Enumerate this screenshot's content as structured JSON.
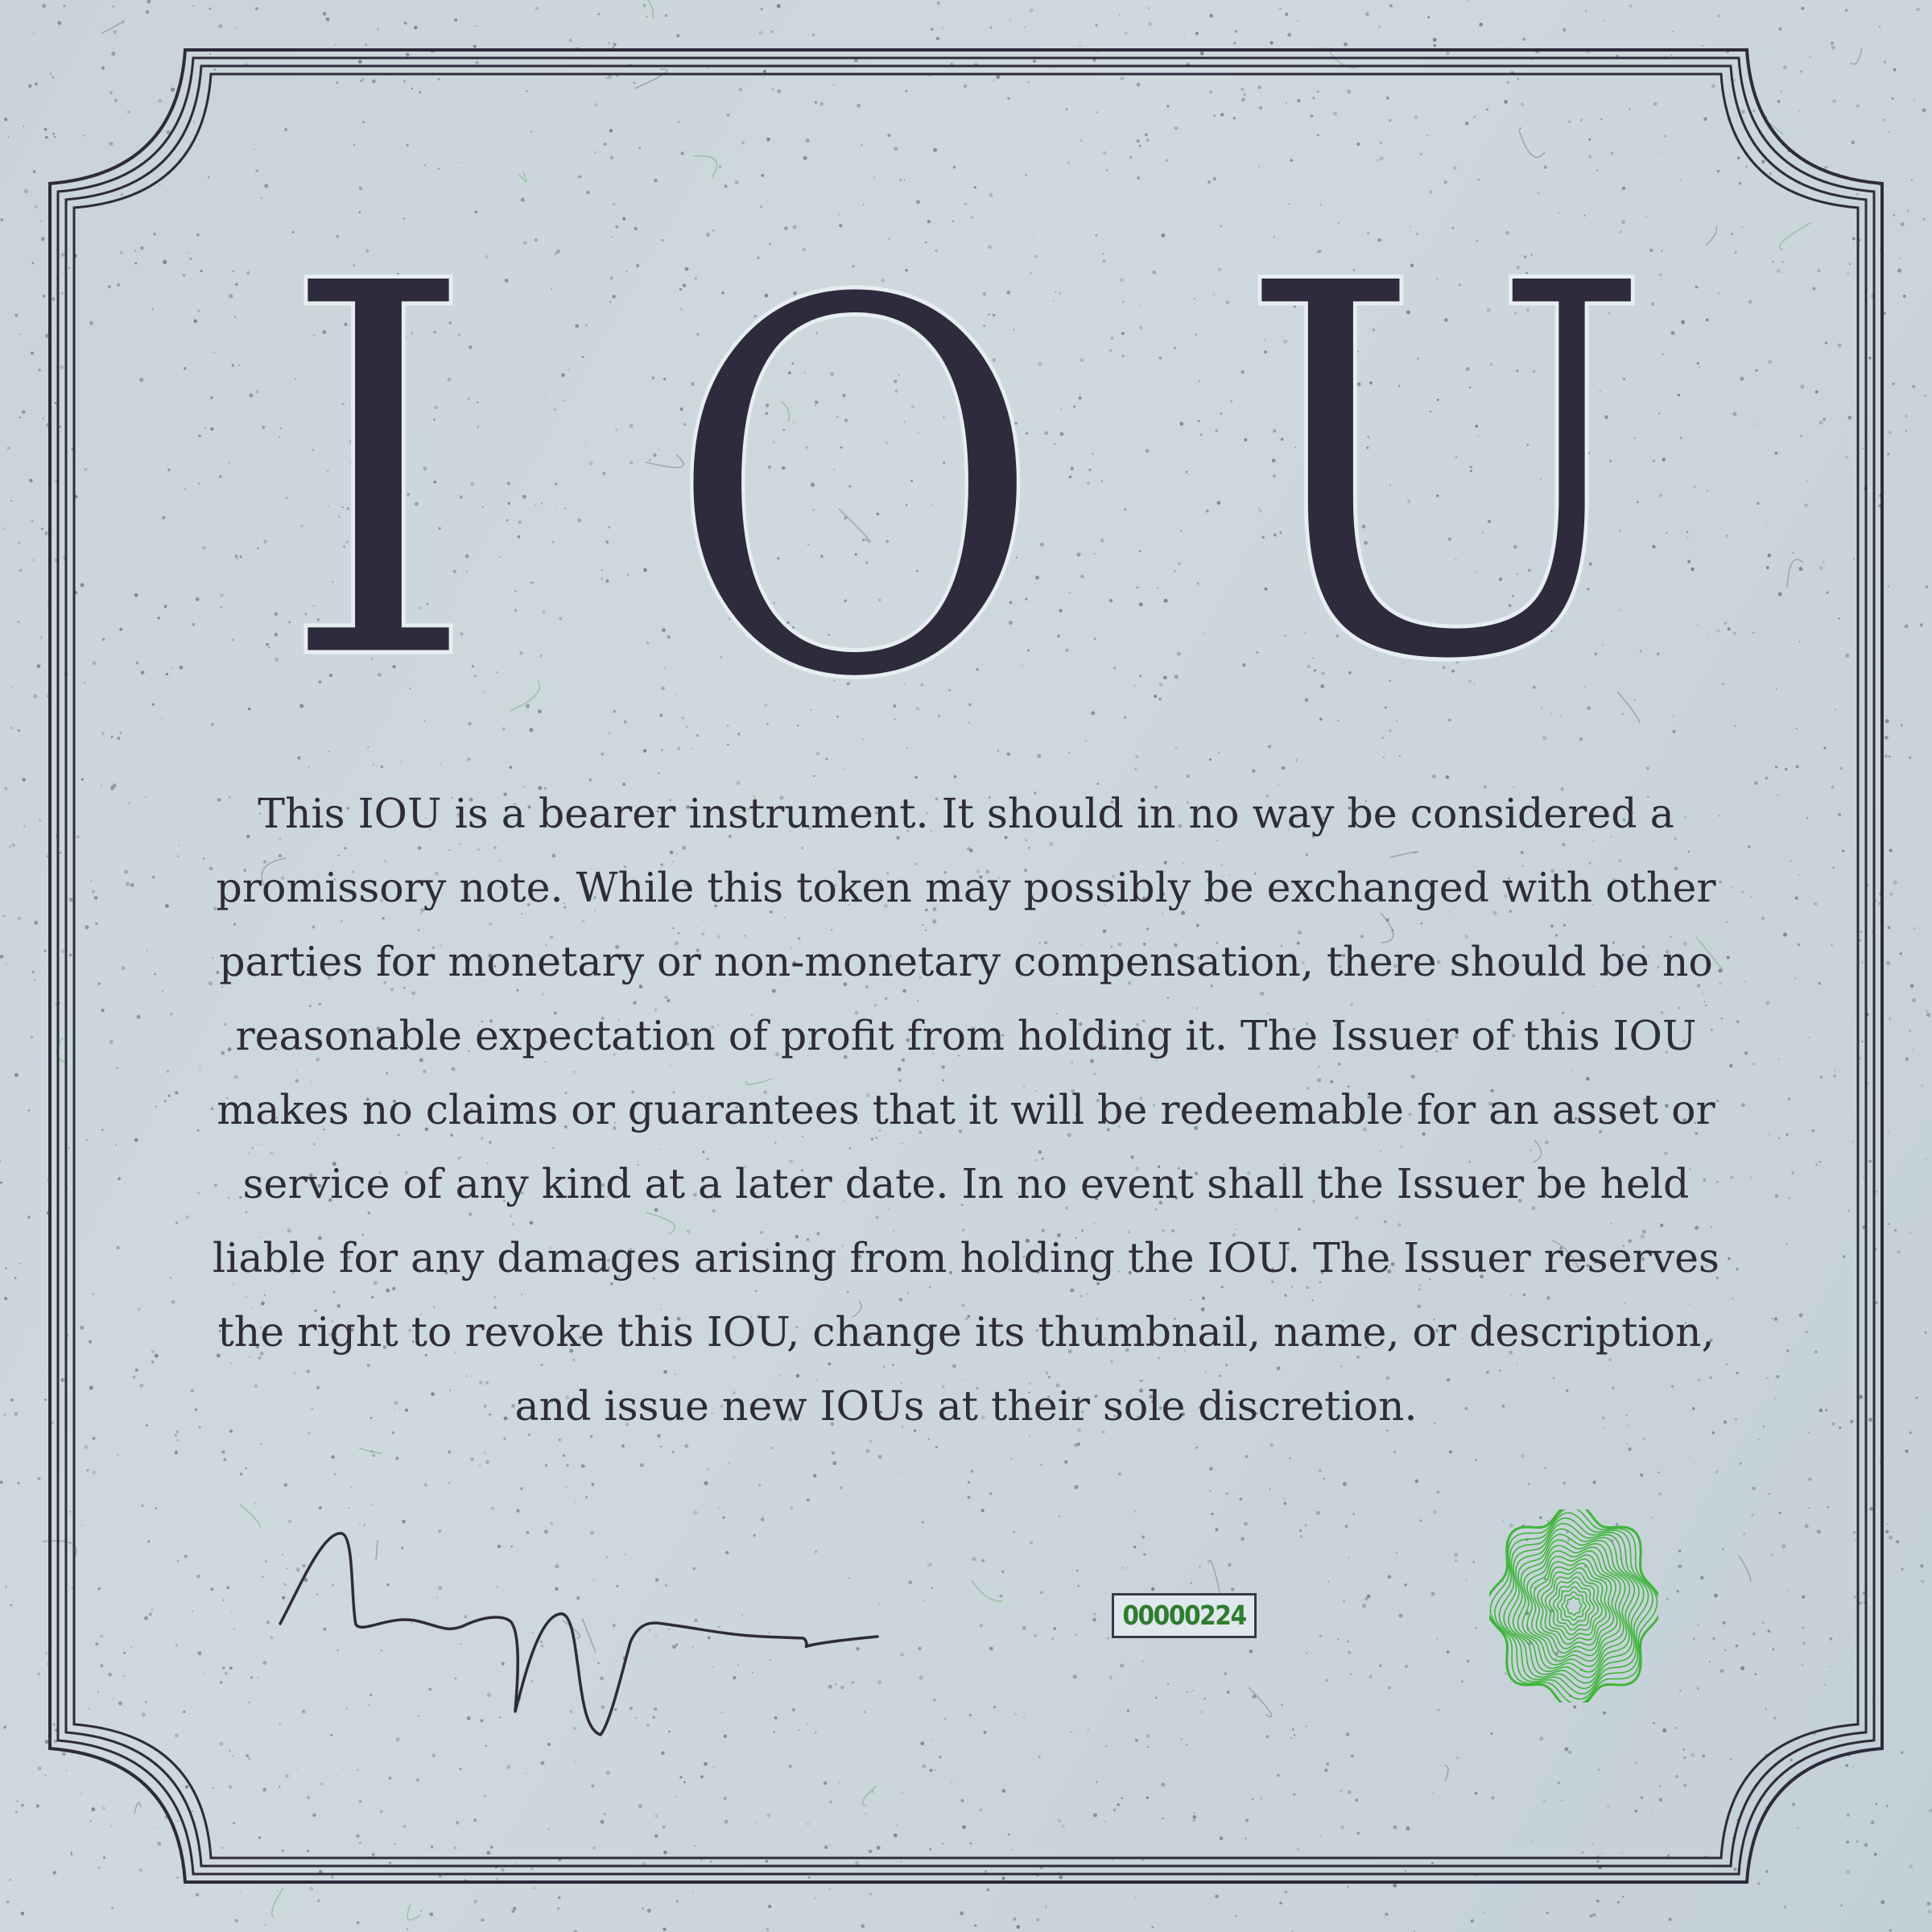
{
  "heading": {
    "letter_1": "I",
    "letter_2": "O",
    "letter_3": "U"
  },
  "disclaimer": "This IOU is a bearer instrument. It should in no way be considered a promissory note. While this token may possibly be exchanged with other parties for monetary or non-monetary compensation, there should be no reasonable expectation of profit from holding it. The Issuer of this IOU makes no claims or guarantees that it will be redeemable for an asset or service of any kind at a later date. In no event shall the Issuer be held liable for any damages arising from holding the IOU. The Issuer reserves the right to revoke this IOU, change its thumbnail, name, or description, and issue new IOUs at their sole discretion.",
  "serial_number": "00000224",
  "colors": {
    "ink": "#2e2b3c",
    "paper": "#cdd8dd",
    "seal": "#3fb53a",
    "serial_text": "#2e7d2e"
  }
}
